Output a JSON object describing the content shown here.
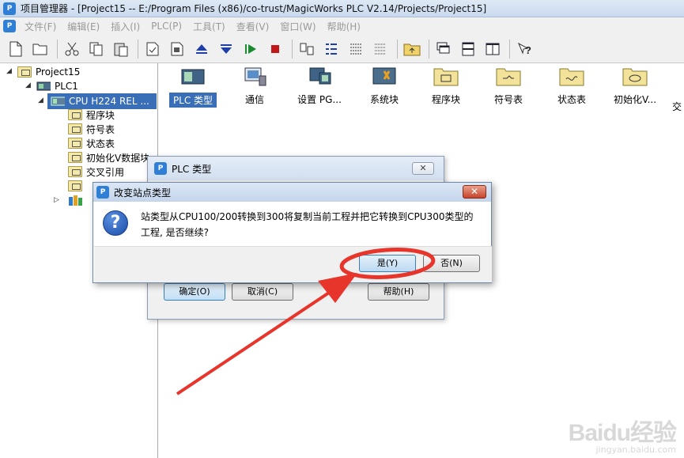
{
  "window": {
    "app_logo_text": "P",
    "title": "项目管理器 - [Project15 -- E:/Program Files (x86)/co-trust/MagicWorks PLC V2.14/Projects/Project15]"
  },
  "menu": [
    {
      "label": "文件(F)"
    },
    {
      "label": "编辑(E)"
    },
    {
      "label": "插入(I)"
    },
    {
      "label": "PLC(P)"
    },
    {
      "label": "工具(T)"
    },
    {
      "label": "查看(V)"
    },
    {
      "label": "窗口(W)"
    },
    {
      "label": "帮助(H)"
    }
  ],
  "toolbar": {
    "icons": [
      "new-file-icon",
      "open-folder-icon",
      "cut-icon",
      "copy-icon",
      "paste-icon",
      "check-icon",
      "download-icon",
      "upload-icon",
      "arrow-down-icon",
      "run-icon",
      "stop-icon",
      "compare-icon",
      "list-icon",
      "details-icon",
      "grid-icon",
      "folder-up-icon",
      "cascade-icon",
      "tile-horizontal-icon",
      "tile-vertical-icon",
      "help-icon"
    ]
  },
  "tree": {
    "project": "Project15",
    "plc": "PLC1",
    "cpu": "CPU H224 REL ...",
    "items": [
      {
        "label": "程序块"
      },
      {
        "label": "符号表"
      },
      {
        "label": "状态表"
      },
      {
        "label": "初始化V数据块"
      },
      {
        "label": "交叉引用"
      }
    ]
  },
  "blocks": [
    {
      "label": "PLC 类型"
    },
    {
      "label": "通信"
    },
    {
      "label": "设置 PG..."
    },
    {
      "label": "系统块"
    },
    {
      "label": "程序块"
    },
    {
      "label": "符号表"
    },
    {
      "label": "状态表"
    },
    {
      "label": "初始化V..."
    },
    {
      "label": "交"
    }
  ],
  "plc_type_dialog": {
    "title": "PLC 类型",
    "close_label": "✕",
    "ok_label": "确定(O)",
    "cancel_label": "取消(C)",
    "help_label": "帮助(H)"
  },
  "confirm_dialog": {
    "title": "改变站点类型",
    "close_label": "✕",
    "icon_text": "?",
    "message": "站类型从CPU100/200转换到300将复制当前工程并把它转换到CPU300类型的工程, 是否继续?",
    "yes_label": "是(Y)",
    "no_label": "否(N)"
  },
  "annotation": {
    "color": "#e8352c"
  },
  "watermark": {
    "main": "Baidu经验",
    "sub": "jingyan.baidu.com"
  }
}
